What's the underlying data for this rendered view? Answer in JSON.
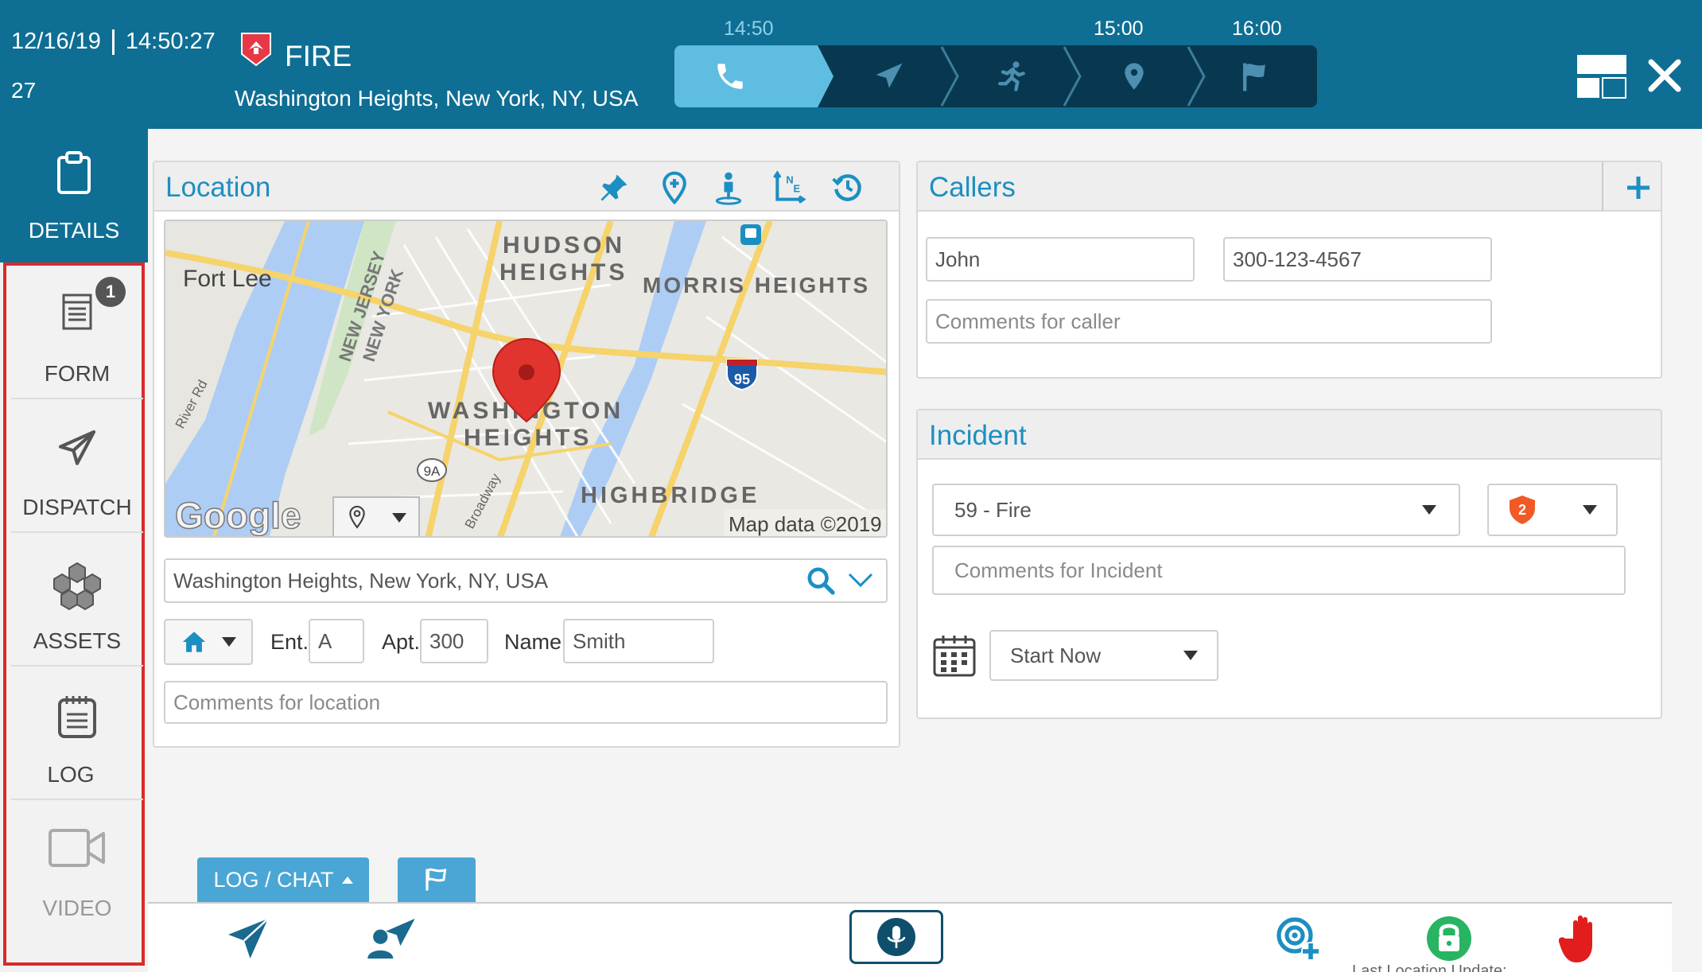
{
  "header": {
    "date": "12/16/19",
    "time": "14:50:27",
    "number": "27",
    "incident_type": "FIRE",
    "address": "Washington Heights, New York, NY, USA",
    "timeline_labels": [
      "14:50",
      "15:00",
      "16:00"
    ],
    "accent": "#0f6e93"
  },
  "sidebar": {
    "items": [
      {
        "label": "DETAILS",
        "icon": "clipboard-icon"
      },
      {
        "label": "FORM",
        "icon": "form-icon",
        "badge": "1"
      },
      {
        "label": "DISPATCH",
        "icon": "paper-plane-icon"
      },
      {
        "label": "ASSETS",
        "icon": "assets-icon"
      },
      {
        "label": "LOG",
        "icon": "notepad-icon"
      },
      {
        "label": "VIDEO",
        "icon": "video-icon"
      }
    ]
  },
  "location": {
    "title": "Location",
    "map_labels": {
      "fort_lee": "Fort Lee",
      "hudson_1": "HUDSON",
      "hudson_2": "HEIGHTS",
      "morris": "MORRIS HEIGHTS",
      "nj": "NEW JERSEY",
      "ny": "NEW YORK",
      "river_rd": "River Rd",
      "wash_1": "WASHINGTON",
      "wash_2": "HEIGHTS",
      "highbridge": "HIGHBRIDGE",
      "broadway": "Broadway",
      "route_9a": "9A",
      "route_95": "95",
      "google": "Google",
      "map_data": "Map data ©2019"
    },
    "address_value": "Washington Heights, New York, NY, USA",
    "ent_label": "Ent.",
    "ent_value": "A",
    "apt_label": "Apt.",
    "apt_value": "300",
    "name_label": "Name",
    "name_value": "Smith",
    "comments_placeholder": "Comments for location"
  },
  "callers": {
    "title": "Callers",
    "name_value": "John",
    "phone_value": "300-123-4567",
    "comments_placeholder": "Comments for caller"
  },
  "incident": {
    "title": "Incident",
    "type_value": "59 - Fire",
    "priority_value": "2",
    "comments_placeholder": "Comments for Incident",
    "start_value": "Start Now"
  },
  "bottom": {
    "log_chat_label": "LOG / CHAT",
    "status_text": "Last Location Update:"
  }
}
